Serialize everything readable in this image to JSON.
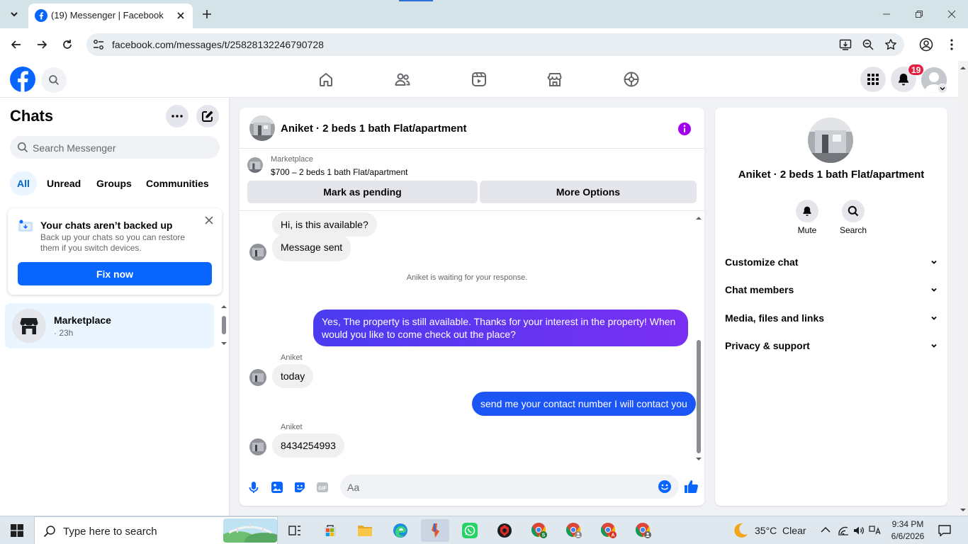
{
  "browser": {
    "tab_title": "(19) Messenger | Facebook",
    "url": "facebook.com/messages/t/25828132246790728"
  },
  "header": {
    "notification_count": "19",
    "brand_color": "#0866ff"
  },
  "sidebar": {
    "title": "Chats",
    "search_placeholder": "Search Messenger",
    "filters": [
      "All",
      "Unread",
      "Groups",
      "Communities"
    ],
    "active_filter": "All",
    "backup_card": {
      "title": "Your chats aren’t backed up",
      "subtitle": "Back up your chats so you can restore them if you switch devices.",
      "button": "Fix now"
    },
    "conversations": [
      {
        "name": "Marketplace",
        "time": "· 23h"
      }
    ]
  },
  "chat": {
    "title": "Aniket · 2 beds 1 bath Flat/apartment",
    "listing": {
      "source": "Marketplace",
      "title": "$700 – 2 beds 1 bath Flat/apartment"
    },
    "actions": [
      "Mark as pending",
      "More Options"
    ],
    "messages": [
      {
        "dir": "in",
        "text": "Hi, is this available?"
      },
      {
        "dir": "in",
        "text": "Message sent"
      },
      {
        "dir": "system",
        "text": "Aniket is waiting for your response."
      },
      {
        "dir": "out",
        "text": "Yes, The property is still available. Thanks for your interest in the property! When would you like to come check out the place?"
      },
      {
        "dir": "in",
        "sender": "Aniket",
        "text": "today"
      },
      {
        "dir": "out",
        "text": "send me your contact number I will contact you"
      },
      {
        "dir": "in",
        "sender": "Aniket",
        "text": "8434254993"
      }
    ],
    "composer_placeholder": "Aa",
    "accent_color": "#7a2ff2"
  },
  "details": {
    "name": "Aniket · 2 beds 1 bath Flat/apartment",
    "buttons": [
      "Mute",
      "Search"
    ],
    "sections": [
      "Customize chat",
      "Chat members",
      "Media, files and links",
      "Privacy & support"
    ]
  },
  "taskbar": {
    "search_placeholder": "Type here to search",
    "weather": "35°C  Clear",
    "time": "9:34 PM",
    "date": "6/6/2026"
  }
}
